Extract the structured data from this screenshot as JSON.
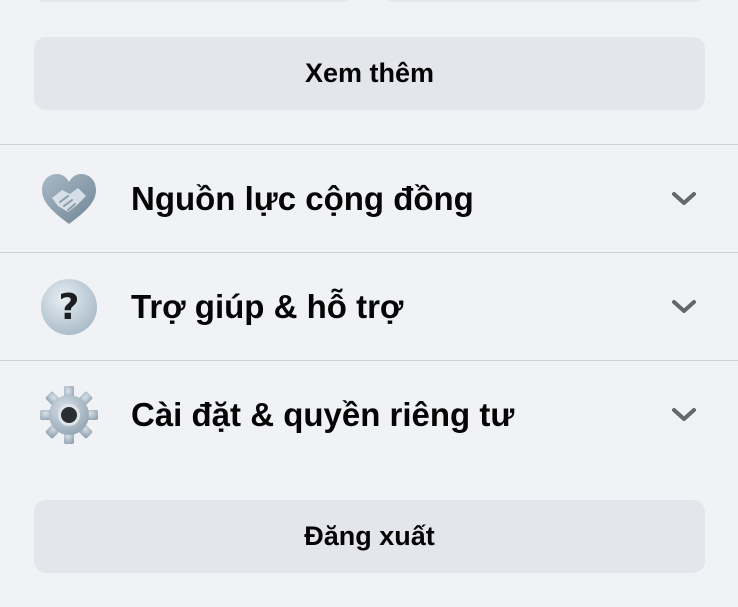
{
  "see_more": {
    "label": "Xem thêm"
  },
  "menu": {
    "items": [
      {
        "label": "Nguồn lực cộng đồng",
        "icon": "handshake-heart-icon"
      },
      {
        "label": "Trợ giúp & hỗ trợ",
        "icon": "help-question-icon"
      },
      {
        "label": "Cài đặt & quyền riêng tư",
        "icon": "gear-icon"
      }
    ]
  },
  "logout": {
    "label": "Đăng xuất"
  },
  "colors": {
    "background": "#f0f2f5",
    "button": "#e4e6eb",
    "divider": "#ced0d4",
    "text": "#050505",
    "chevron": "#65676b"
  }
}
